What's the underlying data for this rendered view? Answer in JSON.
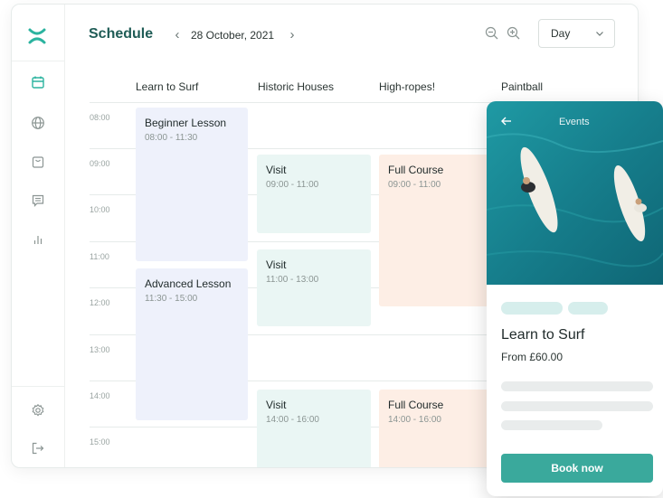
{
  "header": {
    "title": "Schedule",
    "prev_icon": "chevron-left-icon",
    "date": "28 October, 2021",
    "next_icon": "chevron-right-icon",
    "zoom_out_icon": "zoom-out-icon",
    "zoom_in_icon": "zoom-in-icon",
    "view_select": {
      "value": "Day"
    }
  },
  "sidebar": {
    "logo": "brand-logo",
    "items": [
      {
        "icon": "calendar-icon",
        "active": true
      },
      {
        "icon": "globe-icon"
      },
      {
        "icon": "shopping-bag-icon"
      },
      {
        "icon": "message-icon"
      },
      {
        "icon": "bar-chart-icon"
      }
    ],
    "bottom": [
      {
        "icon": "settings-icon"
      },
      {
        "icon": "logout-icon"
      }
    ]
  },
  "columns": [
    "Learn to Surf",
    "Historic Houses",
    "High-ropes!",
    "Paintball"
  ],
  "times": [
    "08:00",
    "09:00",
    "10:00",
    "11:00",
    "12:00",
    "13:00",
    "14:00",
    "15:00"
  ],
  "events": [
    {
      "title": "Beginner Lesson",
      "time": "08:00 - 11:30"
    },
    {
      "title": "Advanced Lesson",
      "time": "11:30 - 15:00"
    },
    {
      "title": "Visit",
      "time": "09:00 - 11:00"
    },
    {
      "title": "Visit",
      "time": "11:00 - 13:00"
    },
    {
      "title": "Visit",
      "time": "14:00 - 16:00"
    },
    {
      "title": "Full Course",
      "time": "09:00 - 11:00"
    },
    {
      "title": "Full Course",
      "time": "14:00 - 16:00"
    }
  ],
  "card": {
    "back_icon": "arrow-left-icon",
    "header": "Events",
    "title": "Learn to Surf",
    "price": "From £60.00",
    "button": "Book now"
  },
  "colors": {
    "brand": "#1f5c56",
    "accent": "#3aa99c",
    "event_blue": "#eef1fb",
    "event_teal": "#eaf6f4",
    "event_peach": "#fdeee5"
  }
}
